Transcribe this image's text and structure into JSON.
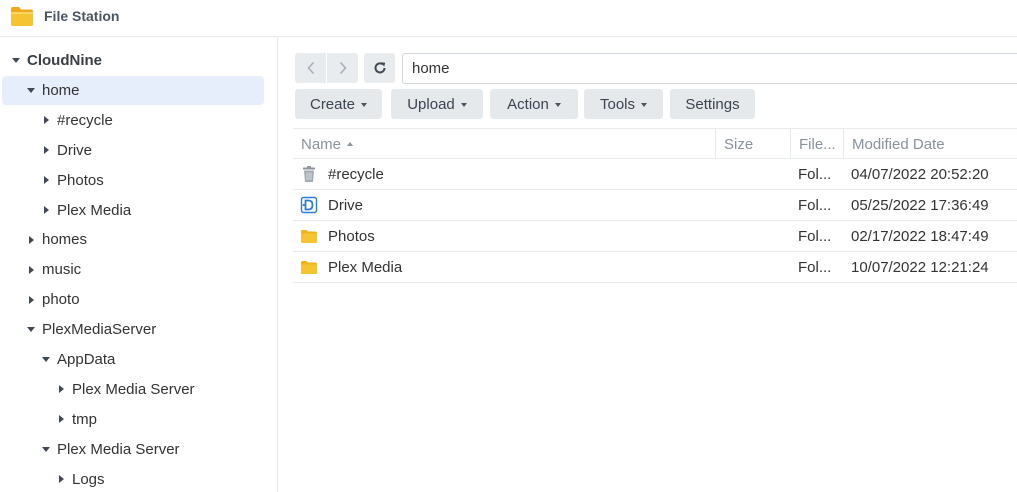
{
  "app": {
    "title": "File Station",
    "icon": "folder-app-icon"
  },
  "sidebar": {
    "items": [
      {
        "label": "CloudNine",
        "level": 0,
        "expanded": true,
        "root": true
      },
      {
        "label": "home",
        "level": 1,
        "expanded": true,
        "selected": true
      },
      {
        "label": "#recycle",
        "level": 2,
        "expanded": false
      },
      {
        "label": "Drive",
        "level": 2,
        "expanded": false
      },
      {
        "label": "Photos",
        "level": 2,
        "expanded": false
      },
      {
        "label": "Plex Media",
        "level": 2,
        "expanded": false
      },
      {
        "label": "homes",
        "level": 1,
        "expanded": false
      },
      {
        "label": "music",
        "level": 1,
        "expanded": false
      },
      {
        "label": "photo",
        "level": 1,
        "expanded": false
      },
      {
        "label": "PlexMediaServer",
        "level": 1,
        "expanded": true
      },
      {
        "label": "AppData",
        "level": 2,
        "expanded": true
      },
      {
        "label": "Plex Media Server",
        "level": 3,
        "expanded": false
      },
      {
        "label": "tmp",
        "level": 3,
        "expanded": false
      },
      {
        "label": "Plex Media Server",
        "level": 2,
        "expanded": true
      },
      {
        "label": "Logs",
        "level": 3,
        "expanded": false
      }
    ]
  },
  "nav": {
    "path": "home"
  },
  "toolbar": {
    "buttons": [
      {
        "label": "Create",
        "dropdown": true
      },
      {
        "label": "Upload",
        "dropdown": true
      },
      {
        "label": "Action",
        "dropdown": true
      },
      {
        "label": "Tools",
        "dropdown": true
      },
      {
        "label": "Settings",
        "dropdown": false
      }
    ]
  },
  "table": {
    "columns": [
      "Name",
      "Size",
      "File...",
      "Modified Date"
    ],
    "sort": {
      "column": "Name",
      "direction": "asc"
    },
    "rows": [
      {
        "icon": "recycle-bin-icon",
        "name": "#recycle",
        "size": "",
        "type": "Fol...",
        "modified": "04/07/2022 20:52:20"
      },
      {
        "icon": "drive-folder-icon",
        "name": "Drive",
        "size": "",
        "type": "Fol...",
        "modified": "05/25/2022 17:36:49"
      },
      {
        "icon": "folder-icon",
        "name": "Photos",
        "size": "",
        "type": "Fol...",
        "modified": "02/17/2022 18:47:49"
      },
      {
        "icon": "folder-icon",
        "name": "Plex Media",
        "size": "",
        "type": "Fol...",
        "modified": "10/07/2022 12:21:24"
      }
    ]
  },
  "colors": {
    "selected_bg": "#e5eefa",
    "folder": "#f6c433",
    "button_bg": "#e6e9ec",
    "drive_blue": "#2e7bd6"
  }
}
